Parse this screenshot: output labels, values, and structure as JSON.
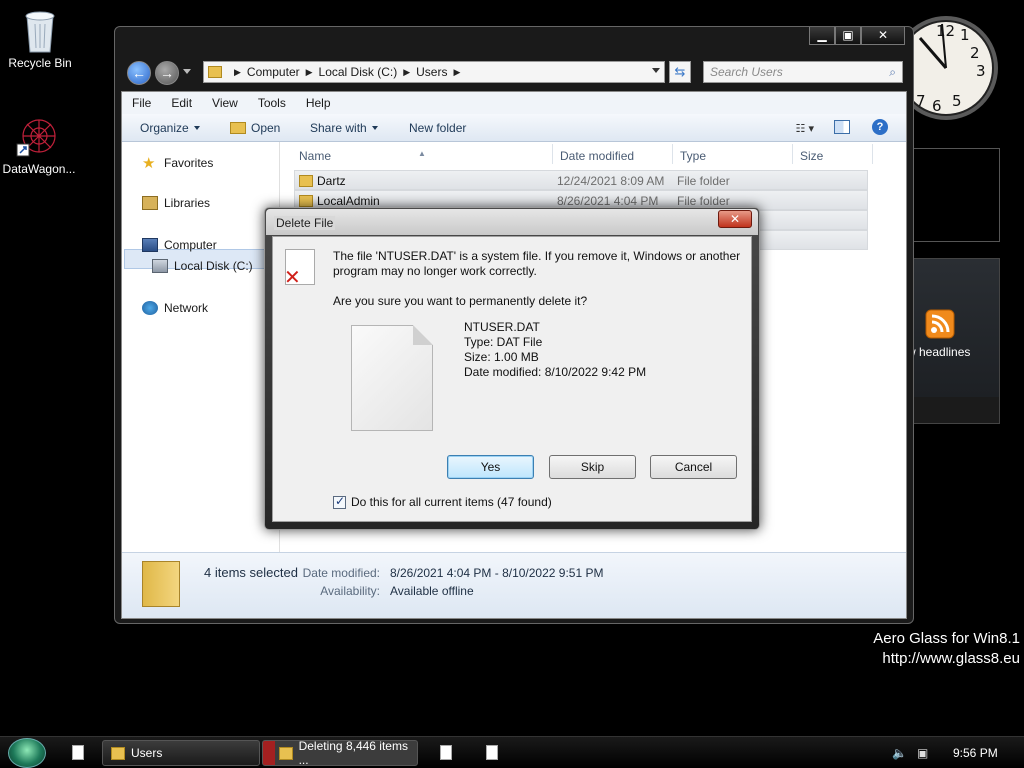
{
  "desktop": {
    "icons": [
      {
        "label": "Recycle Bin"
      },
      {
        "label": "DataWagon..."
      }
    ],
    "feed_gadget_text": "w headlines",
    "watermark_line1": "Aero Glass for Win8.1",
    "watermark_line2": "http://www.glass8.eu"
  },
  "clock_gadget": {
    "numerals": [
      "12",
      "1",
      "2",
      "3",
      "5",
      "6",
      "7"
    ]
  },
  "explorer": {
    "breadcrumb": [
      "Computer",
      "Local Disk (C:)",
      "Users"
    ],
    "search_placeholder": "Search Users",
    "menu": [
      "File",
      "Edit",
      "View",
      "Tools",
      "Help"
    ],
    "commands": {
      "organize": "Organize",
      "open": "Open",
      "share_with": "Share with",
      "new_folder": "New folder"
    },
    "nav": {
      "favorites": "Favorites",
      "libraries": "Libraries",
      "computer": "Computer",
      "local_disk": "Local Disk (C:)",
      "network": "Network"
    },
    "columns": {
      "name": "Name",
      "date_modified": "Date modified",
      "type": "Type",
      "size": "Size"
    },
    "rows": [
      {
        "name": "Dartz",
        "date": "12/24/2021 8:09 AM",
        "type": "File folder"
      },
      {
        "name": "LocalAdmin",
        "date": "8/26/2021 4:04 PM",
        "type": "File folder"
      }
    ],
    "details": {
      "selection": "4 items selected",
      "date_label": "Date modified:",
      "date_value": "8/26/2021 4:04 PM - 8/10/2022 9:51 PM",
      "availability_label": "Availability:",
      "availability_value": "Available offline"
    }
  },
  "dialog": {
    "title": "Delete File",
    "message": "The file 'NTUSER.DAT' is a system file. If you remove it, Windows or another program may no longer work correctly.",
    "question": "Are you sure you want to permanently delete it?",
    "file": {
      "name": "NTUSER.DAT",
      "type": "Type: DAT File",
      "size": "Size: 1.00 MB",
      "modified": "Date modified: 8/10/2022 9:42 PM"
    },
    "buttons": {
      "yes": "Yes",
      "skip": "Skip",
      "cancel": "Cancel"
    },
    "checkbox_label": "Do this for all current items (47 found)",
    "checkbox_checked": true
  },
  "taskbar": {
    "users_label": "Users",
    "deleting_label": "Deleting 8,446 items ...",
    "time": "9:56 PM"
  }
}
